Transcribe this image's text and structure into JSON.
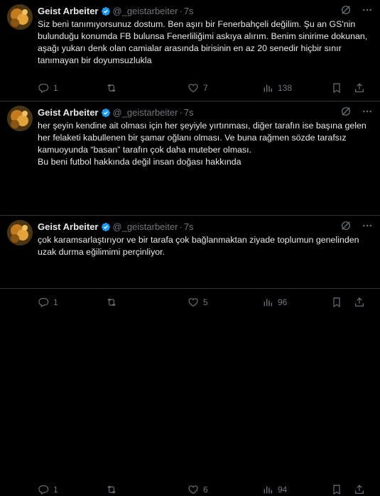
{
  "tweets": [
    {
      "name": "Geist Arbeiter",
      "handle": "@_geistarbeiter",
      "separator": "·",
      "time": "7s",
      "text": "Siz beni tanımıyorsunuz dostum. Ben aşırı bir Fenerbahçeli değilim. Şu an GS'nin bulunduğu konumda FB bulunsa Fenerliliğimi askıya alırım. Benim sinirime dokunan, aşağı yukarı denk olan camialar arasında birisinin en az 20 senedir hiçbir sınır tanımayan bir doyumsuzlukla",
      "replies": "1",
      "retweets": "",
      "likes": "7",
      "views": "138"
    },
    {
      "name": "Geist Arbeiter",
      "handle": "@_geistarbeiter",
      "separator": "·",
      "time": "7s",
      "text": "her şeyin kendine ait olması için her şeyiyle yırtınması, diğer tarafın ise başına gelen her felaketi kabullenen bir şamar oğlanı olması. Ve buna rağmen sözde tarafsız kamuoyunda “basan” tarafın çok daha muteber olması.\nBu beni futbol hakkında değil insan doğası hakkında",
      "replies": "1",
      "retweets": "",
      "likes": "5",
      "views": "96"
    },
    {
      "name": "Geist Arbeiter",
      "handle": "@_geistarbeiter",
      "separator": "·",
      "time": "7s",
      "text": "çok karamsarlaştırıyor ve bir tarafa çok bağlanmaktan ziyade toplumun genelinden uzak durma eğilimimi perçinliyor.",
      "replies": "1",
      "retweets": "",
      "likes": "6",
      "views": "94"
    }
  ],
  "colors": {
    "background": "#000000",
    "text": "#e7e9ea",
    "muted": "#71767b",
    "verified": "#1d9bf0",
    "divider": "#2f3336"
  },
  "icons": [
    "verified-badge-icon",
    "grok-icon",
    "more-icon",
    "reply-icon",
    "retweet-icon",
    "like-icon",
    "views-icon",
    "bookmark-icon",
    "share-icon"
  ]
}
